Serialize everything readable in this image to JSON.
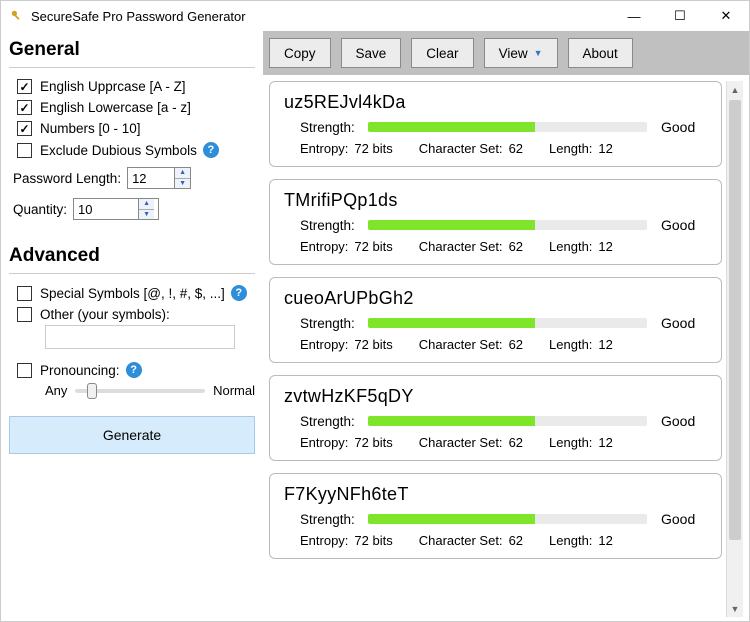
{
  "window": {
    "title": "SecureSafe Pro Password Generator"
  },
  "sidebar": {
    "general": {
      "title": "General",
      "uppercase": {
        "checked": true,
        "label": "English Upprcase [A - Z]"
      },
      "lowercase": {
        "checked": true,
        "label": "English Lowercase [a - z]"
      },
      "numbers": {
        "checked": true,
        "label": "Numbers [0 - 10]"
      },
      "exclude": {
        "checked": false,
        "label": "Exclude Dubious Symbols"
      },
      "length": {
        "label": "Password Length:",
        "value": "12"
      },
      "quantity": {
        "label": "Quantity:",
        "value": "10"
      }
    },
    "advanced": {
      "title": "Advanced",
      "special": {
        "checked": false,
        "label": "Special Symbols [@, !, #, $, ...]"
      },
      "other": {
        "checked": false,
        "label": "Other (your symbols):",
        "value": ""
      },
      "pronouncing": {
        "checked": false,
        "label": "Pronouncing:",
        "left": "Any",
        "right": "Normal"
      }
    },
    "generate_label": "Generate"
  },
  "toolbar": {
    "copy": "Copy",
    "save": "Save",
    "clear": "Clear",
    "view": "View",
    "about": "About"
  },
  "results": {
    "strength_label": "Strength:",
    "entropy_label": "Entropy:",
    "charset_label": "Character Set:",
    "length_label": "Length:",
    "items": [
      {
        "password": "uz5REJvl4kDa",
        "strength_text": "Good",
        "strength_pct": 60,
        "entropy": "72  bits",
        "charset": "62",
        "length": "12"
      },
      {
        "password": "TMrifiPQp1ds",
        "strength_text": "Good",
        "strength_pct": 60,
        "entropy": "72  bits",
        "charset": "62",
        "length": "12"
      },
      {
        "password": "cueoArUPbGh2",
        "strength_text": "Good",
        "strength_pct": 60,
        "entropy": "72  bits",
        "charset": "62",
        "length": "12"
      },
      {
        "password": "zvtwHzKF5qDY",
        "strength_text": "Good",
        "strength_pct": 60,
        "entropy": "72  bits",
        "charset": "62",
        "length": "12"
      },
      {
        "password": "F7KyyNFh6teT",
        "strength_text": "Good",
        "strength_pct": 60,
        "entropy": "72  bits",
        "charset": "62",
        "length": "12"
      }
    ]
  }
}
